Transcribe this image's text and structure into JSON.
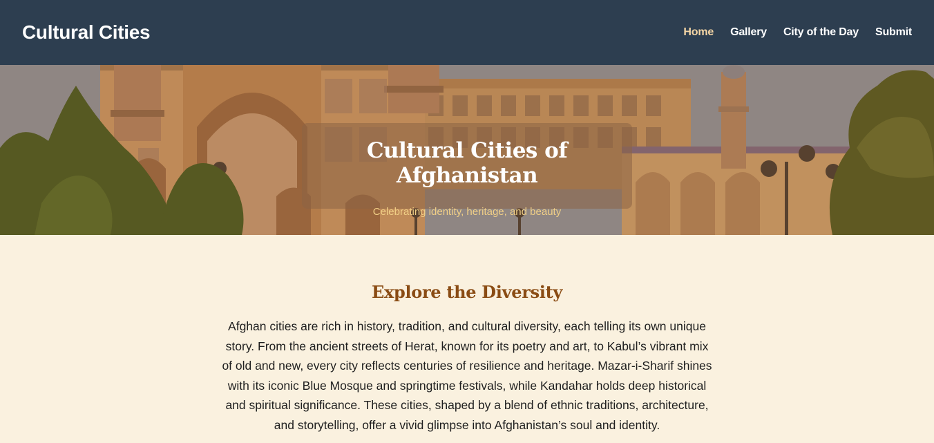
{
  "header": {
    "brand": "Cultural Cities",
    "nav": [
      {
        "label": "Home",
        "active": true
      },
      {
        "label": "Gallery",
        "active": false
      },
      {
        "label": "City of the Day",
        "active": false
      },
      {
        "label": "Submit",
        "active": false
      }
    ],
    "background_color": "#2d3e50",
    "active_color": "#f6d7a6"
  },
  "hero": {
    "title": "Cultural Cities of Afghanistan",
    "subtitle": "Celebrating identity, heritage, and beauty",
    "image": "mosque-photo"
  },
  "main": {
    "heading": "Explore the Diversity",
    "paragraph": "Afghan cities are rich in history, tradition, and cultural diversity, each telling its own unique story. From the ancient streets of Herat, known for its poetry and art, to Kabul’s vibrant mix of old and new, every city reflects centuries of resilience and heritage. Mazar-i-Sharif shines with its iconic Blue Mosque and springtime festivals, while Kandahar holds deep historical and spiritual significance. These cities, shaped by a blend of ethnic traditions, architecture, and storytelling, offer a vivid glimpse into Afghanistan’s soul and identity.",
    "heading_color": "#8a4c14",
    "background_color": "#faf1df"
  }
}
